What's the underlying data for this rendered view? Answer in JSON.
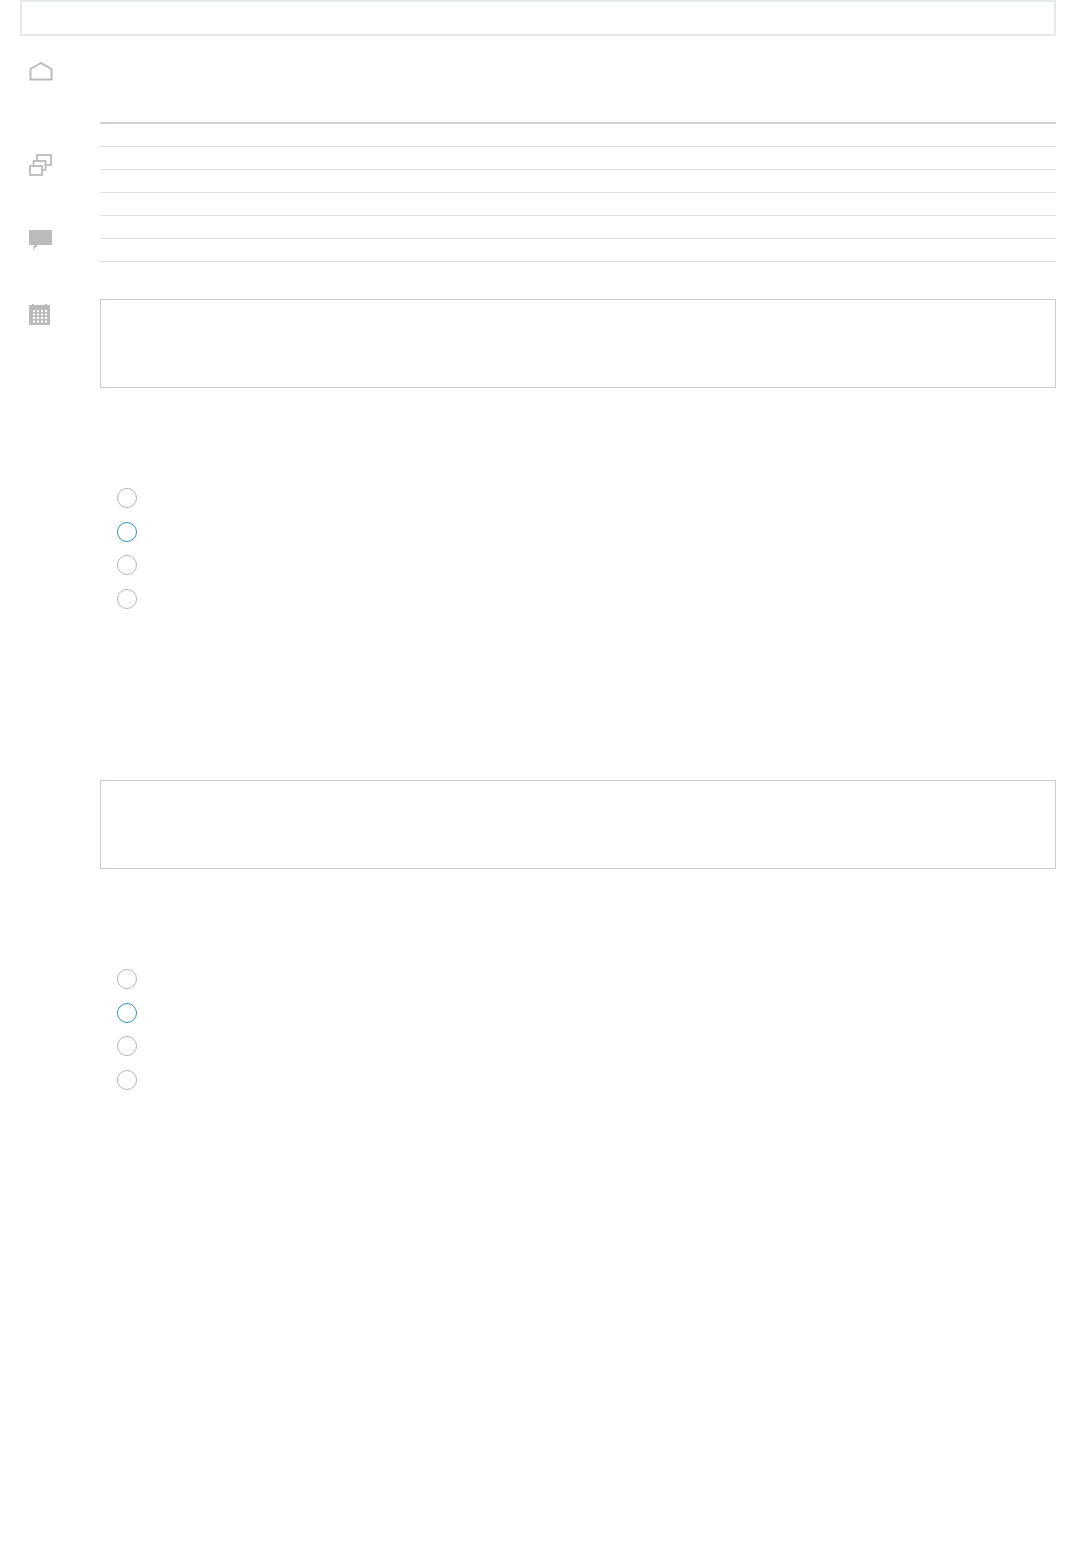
{
  "sidebar": {
    "items": [
      {
        "kind": "home"
      },
      {
        "kind": "windows"
      },
      {
        "kind": "chat"
      },
      {
        "kind": "calendar"
      }
    ]
  },
  "questions": [
    {
      "options": [
        {
          "color": "#b5b5b5"
        },
        {
          "color": "#2a96c0"
        },
        {
          "color": "#b5b5b5"
        },
        {
          "color": "#b5b5b5"
        }
      ]
    },
    {
      "options": [
        {
          "color": "#b5b5b5"
        },
        {
          "color": "#2a96c0"
        },
        {
          "color": "#b5b5b5"
        },
        {
          "color": "#b5b5b5"
        }
      ]
    }
  ]
}
